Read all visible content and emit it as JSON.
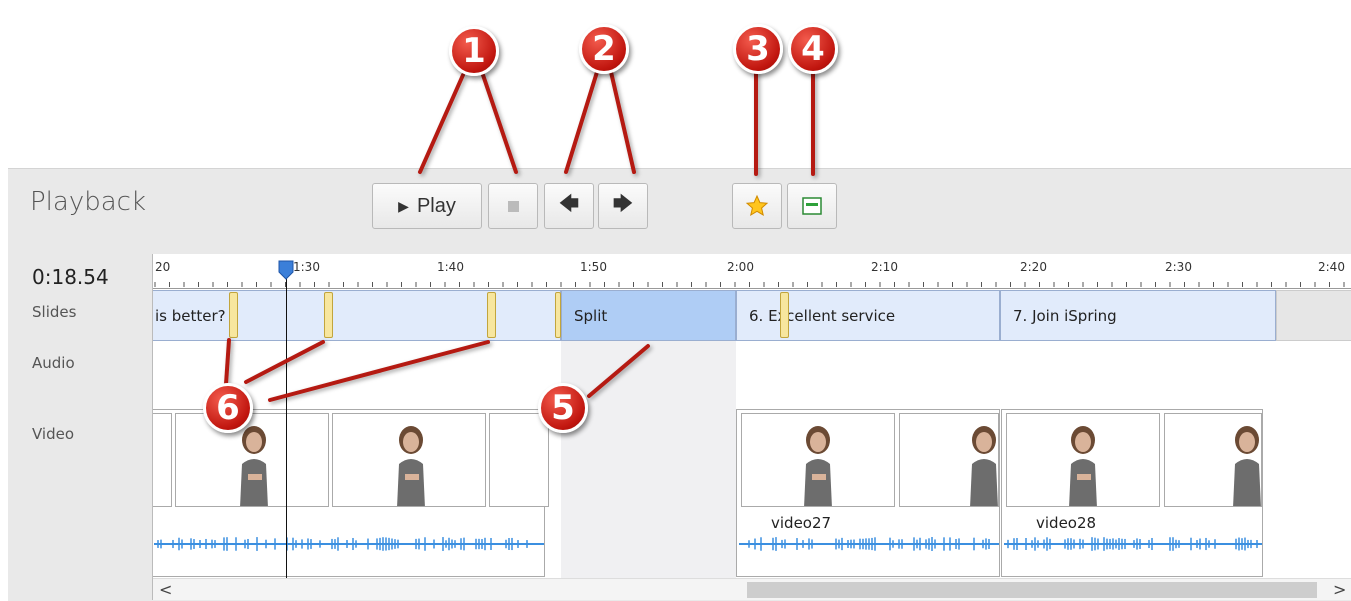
{
  "panel": {
    "title": "Playback"
  },
  "toolbar": {
    "play_label": "Play",
    "play_icon": "play-triangle-icon",
    "stop_icon": "stop-square-icon",
    "prev_icon": "arrow-left-icon",
    "next_icon": "arrow-right-icon",
    "star_icon": "star-icon",
    "slide_icon": "slide-icon"
  },
  "time": {
    "current": "0:18.54"
  },
  "rows": {
    "slides": "Slides",
    "audio": "Audio",
    "video": "Video"
  },
  "ruler": {
    "ticks": [
      "20",
      "1:30",
      "1:40",
      "1:50",
      "2:00",
      "2:10",
      "2:20",
      "2:30",
      "2:40"
    ]
  },
  "slides": [
    {
      "label": "is better?"
    },
    {
      "label": "Split"
    },
    {
      "label": "6. Excellent service"
    },
    {
      "label": "7. Join iSpring"
    }
  ],
  "clips": [
    {
      "label": ""
    },
    {
      "label": "video27"
    },
    {
      "label": "video28"
    }
  ],
  "scroll": {
    "left": "<",
    "right": ">"
  },
  "callouts": [
    "1",
    "2",
    "3",
    "4",
    "5",
    "6"
  ],
  "colors": {
    "callout": "#c0150e",
    "split_slide": "#afcdf5",
    "slide": "#e1ebfb",
    "waveform": "#3b8fe0",
    "marker": "#f7e69e"
  }
}
